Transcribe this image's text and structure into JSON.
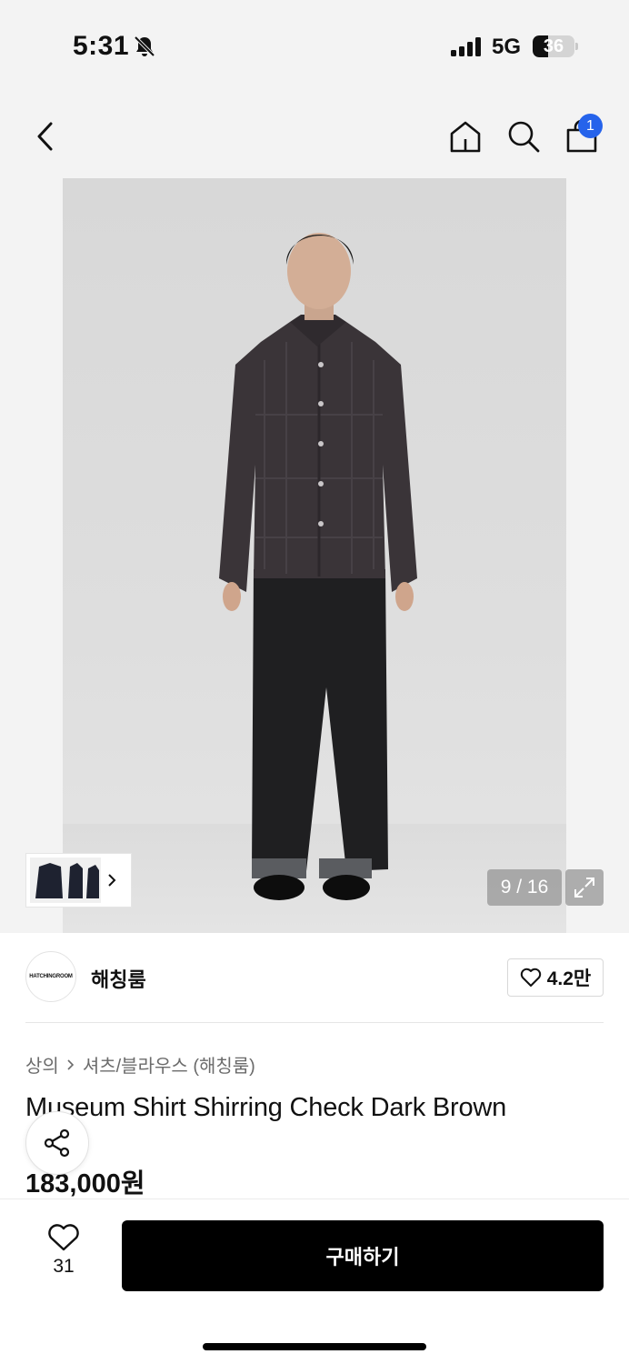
{
  "status_bar": {
    "time": "5:31",
    "network": "5G",
    "battery": "36",
    "battery_level": 0.36
  },
  "nav": {
    "cart_count": "1"
  },
  "gallery": {
    "counter": "9 / 16"
  },
  "brand": {
    "name": "해칭룸",
    "logo_text": "HATCHINGROOM",
    "likes": "4.2만"
  },
  "breadcrumb": {
    "category": "상의",
    "subcategory": "셔츠/블라우스 (해칭룸)"
  },
  "product": {
    "title": "Museum Shirt Shirring Check Dark Brown",
    "price": "183,000원"
  },
  "bottom_bar": {
    "wish_count": "31",
    "buy_label": "구매하기"
  },
  "colors": {
    "accent": "#2563eb",
    "buy_button": "#000000"
  }
}
